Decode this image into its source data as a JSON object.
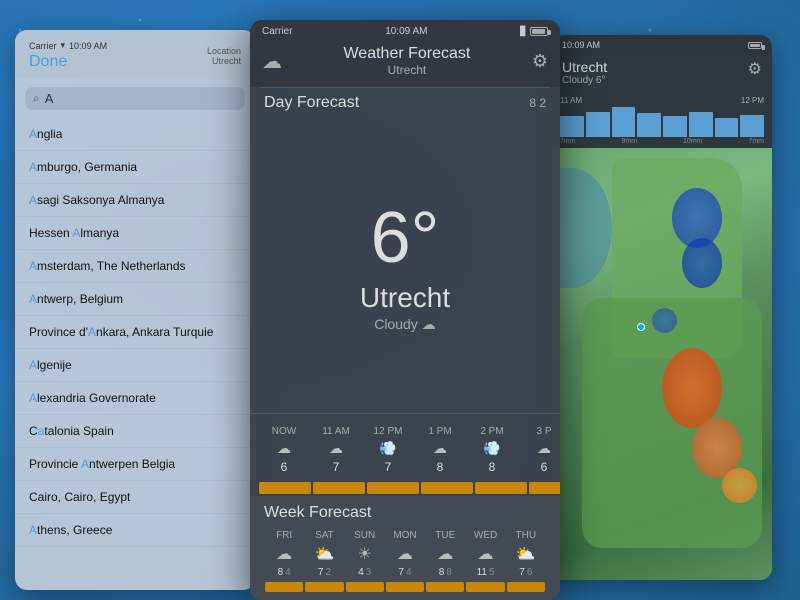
{
  "background": {
    "color": "#2a6fa8"
  },
  "panel_left": {
    "status_bar": {
      "carrier": "Carrier",
      "time": "10:09 AM"
    },
    "header": {
      "done_label": "Done",
      "location_label": "Location",
      "city": "Utrecht"
    },
    "search": {
      "placeholder": "A"
    },
    "locations": [
      {
        "name": "Anglia",
        "highlight_char": "A"
      },
      {
        "name": "Amburgo, Germania",
        "highlight_char": "A"
      },
      {
        "name": "Asagi Saksonya Almanya",
        "highlight_char": "A"
      },
      {
        "name": "Hessen Almanya",
        "highlight_char": "A"
      },
      {
        "name": "Amsterdam, The Netherlands",
        "highlight_char": "A"
      },
      {
        "name": "Antwerp, Belgium",
        "highlight_char": "A"
      },
      {
        "name": "Province d'Ankara, Ankara Turquie",
        "highlight_char": "A"
      },
      {
        "name": "Algenije",
        "highlight_char": "A"
      },
      {
        "name": "Alexandria Governorate",
        "highlight_char": "A"
      },
      {
        "name": "Catalonia Spain",
        "highlight_char": "A"
      },
      {
        "name": "Provincie Antwerpen Belgia",
        "highlight_char": "A"
      },
      {
        "name": "Cairo, Cairo, Egypt",
        "highlight_char": "A"
      },
      {
        "name": "Athens, Greece",
        "highlight_char": "A"
      }
    ]
  },
  "panel_center": {
    "status_bar": {
      "carrier": "Carrier",
      "time": "10:09 AM"
    },
    "app_title": "Weather Forecast",
    "app_city": "Utrecht",
    "section_header": "Day Forecast",
    "forecast_count": "8  2",
    "temperature": "6°",
    "city": "Utrecht",
    "condition": "Cloudy",
    "hourly": [
      {
        "label": "NOW",
        "icon": "☁",
        "temp": "6"
      },
      {
        "label": "11 AM",
        "icon": "☁",
        "temp": "7"
      },
      {
        "label": "12 PM",
        "icon": "🌬",
        "temp": "7"
      },
      {
        "label": "1 PM",
        "icon": "☁",
        "temp": "8"
      },
      {
        "label": "2 PM",
        "icon": "🌬",
        "temp": "8"
      },
      {
        "label": "3 P",
        "icon": "☁",
        "temp": "6"
      }
    ],
    "week_forecast_label": "Week Forecast",
    "week_days": [
      {
        "label": "FRI",
        "icon": "☁",
        "hi": "8",
        "lo": "4"
      },
      {
        "label": "SAT",
        "icon": "⛅",
        "hi": "7",
        "lo": "2"
      },
      {
        "label": "SUN",
        "icon": "☀",
        "hi": "4",
        "lo": "3"
      },
      {
        "label": "MON",
        "icon": "☁",
        "hi": "7",
        "lo": "4"
      },
      {
        "label": "TUE",
        "icon": "☁",
        "hi": "8",
        "lo": "8"
      },
      {
        "label": "WED",
        "icon": "☁",
        "hi": "11",
        "lo": "5"
      },
      {
        "label": "THU",
        "icon": "⛅",
        "hi": "7",
        "lo": "6"
      }
    ]
  },
  "panel_right": {
    "status_bar": {
      "time": "10:09 AM"
    },
    "city": "Utrecht",
    "condition": "Cloudy 6°",
    "precip_labels": [
      "11 AM",
      "12 PM"
    ],
    "precip_mm": [
      "7mm",
      "9mm",
      "10mm",
      "7mm"
    ],
    "precip_bar_heights": [
      70,
      85,
      100,
      70
    ]
  },
  "icons": {
    "cloud": "☁",
    "gear": "⚙",
    "search": "Q",
    "partly_cloudy": "⛅",
    "sun": "☀",
    "wind": "💨"
  }
}
